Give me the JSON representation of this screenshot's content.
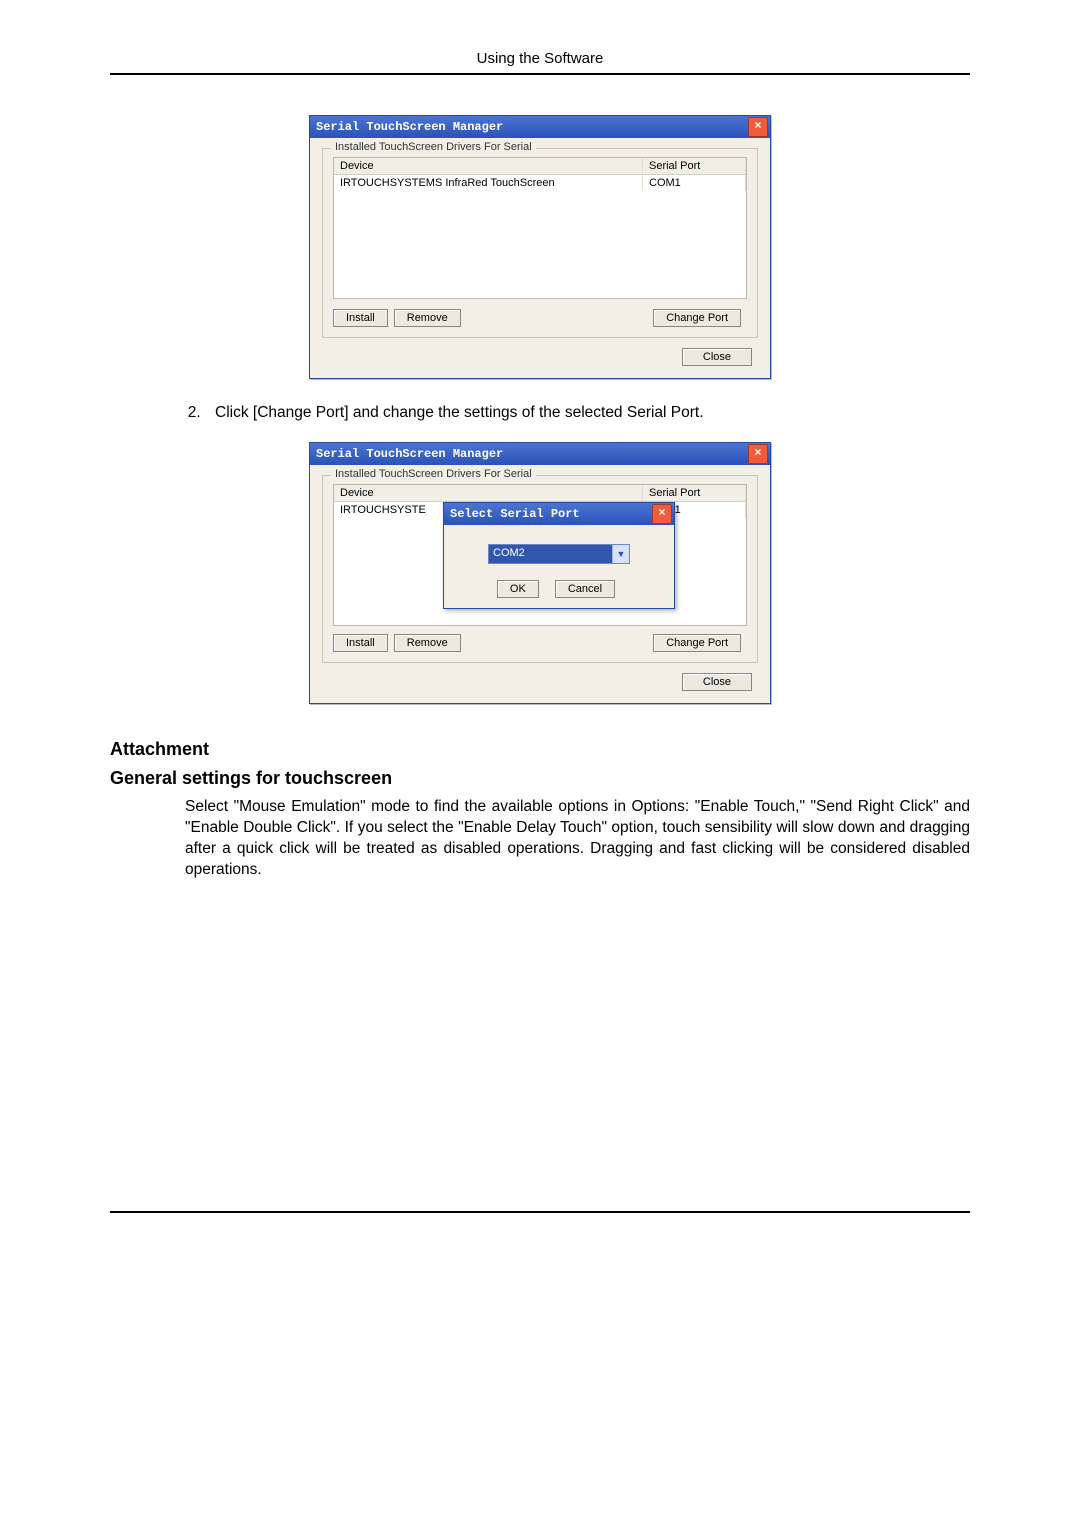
{
  "header": {
    "title": "Using the Software"
  },
  "dialog1": {
    "title": "Serial TouchScreen Manager",
    "group_title": "Installed TouchScreen Drivers For Serial",
    "col_device": "Device",
    "col_port": "Serial Port",
    "row_device": "IRTOUCHSYSTEMS InfraRed TouchScreen",
    "row_port": "COM1",
    "btn_install": "Install",
    "btn_remove": "Remove",
    "btn_changeport": "Change Port",
    "btn_close": "Close"
  },
  "step2": {
    "text": "Click [Change Port] and change the settings of the selected Serial Port."
  },
  "dialog2": {
    "title": "Serial TouchScreen Manager",
    "group_title": "Installed TouchScreen Drivers For Serial",
    "col_device": "Device",
    "col_port": "Serial Port",
    "row_device": "IRTOUCHSYSTE",
    "row_port": "COM1",
    "btn_install": "Install",
    "btn_remove": "Remove",
    "btn_changeport": "Change Port",
    "btn_close": "Close",
    "popup": {
      "title": "Select Serial Port",
      "value": "COM2",
      "btn_ok": "OK",
      "btn_cancel": "Cancel"
    }
  },
  "section": {
    "h_attachment": "Attachment",
    "h_general": "General settings for touchscreen",
    "body": "Select \"Mouse Emulation\" mode to find the available options in Options: \"Enable Touch,\" \"Send Right Click\" and \"Enable Double Click\". If you select the \"Enable Delay Touch\" option, touch sensibility will slow down and dragging after a quick click will be treated as disabled operations. Dragging and fast clicking will be considered disabled operations."
  }
}
